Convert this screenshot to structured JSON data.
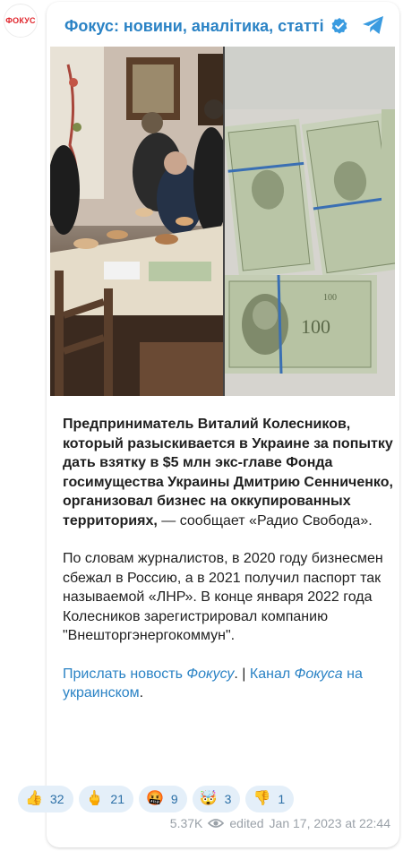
{
  "avatar": {
    "label": "ФОКУС"
  },
  "header": {
    "channel_name": "Фокус: новини, аналітика, статті"
  },
  "post": {
    "paragraph1": "Предприниматель Виталий Колесников, который разыскивается в Украине за попытку дать взятку в $5 млн экс-главе Фонда госимущества Украины Дмитрию Сенниченко, организовал бизнес на оккупированных территориях,",
    "paragraph1_tail": " — сообщает «Радио Свобода».",
    "paragraph2": "По словам журналистов, в 2020 году бизнесмен сбежал в Россию, а в 2021 получил паспорт так называемой «ЛНР». В конце января 2022 года Колесников зарегистрировал компанию \"Внешторгэнергокоммун\".",
    "link1_text": "Прислать новость ",
    "link1_italic": "Фокусу",
    "separator": ". | ",
    "link2_text": "Канал ",
    "link2_italic": "Фокуса",
    "link2_tail": " на украинском",
    "trailing": "."
  },
  "reactions": [
    {
      "emoji": "👍",
      "count": "32"
    },
    {
      "emoji": "🖕",
      "count": "21"
    },
    {
      "emoji": "🤬",
      "count": "9"
    },
    {
      "emoji": "🤯",
      "count": "3"
    },
    {
      "emoji": "👎",
      "count": "1"
    }
  ],
  "footer": {
    "views": "5.37K",
    "edited_label": "edited",
    "timestamp": "Jan 17, 2023 at 22:44"
  },
  "colors": {
    "accent": "#2b83c5",
    "reaction_bg": "#e4eff9",
    "brand_red": "#e0252c"
  }
}
